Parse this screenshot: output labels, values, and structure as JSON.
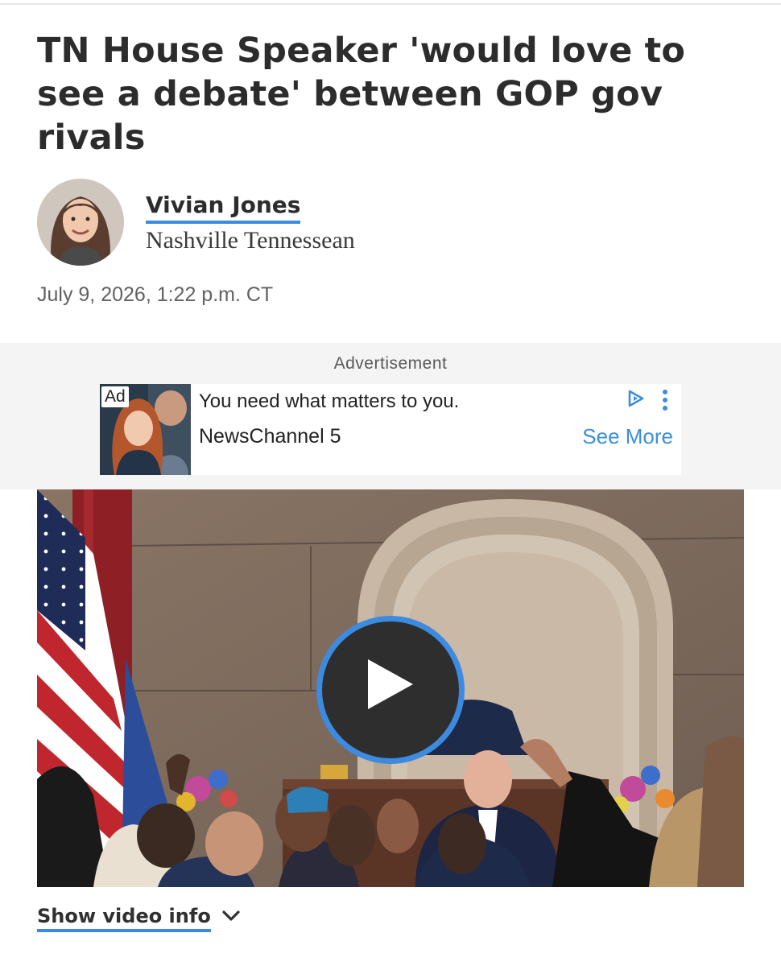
{
  "article": {
    "headline": "TN House Speaker 'would love to see a debate' between GOP gov rivals",
    "author": "Vivian Jones",
    "publication": "Nashville Tennessean",
    "date": "July 9, 2026, 1:22 p.m. CT"
  },
  "ad": {
    "label": "Advertisement",
    "badge": "Ad",
    "headline": "You need what matters to you.",
    "advertiser": "NewsChannel 5",
    "cta": "See More"
  },
  "video": {
    "show_info_label": "Show video info"
  },
  "icons": {
    "play": "play-icon",
    "chevron": "chevron-down-icon",
    "adchoices": "adchoices-icon",
    "menu": "kebab-menu-icon"
  },
  "colors": {
    "accent": "#3d8be0",
    "cta": "#3a8fdd",
    "ad_background": "#f4f4f4"
  }
}
